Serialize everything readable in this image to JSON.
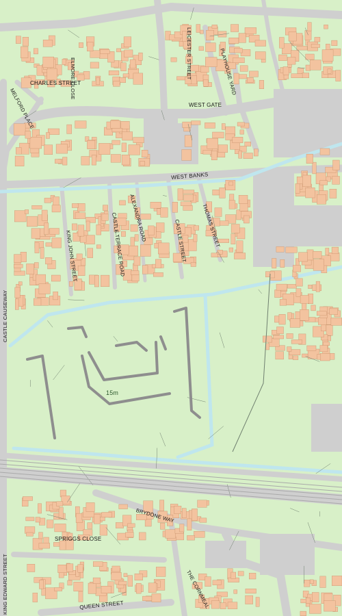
{
  "map": {
    "colors": {
      "land": "#d8f0c8",
      "building": "#f3c39f",
      "road": "#cfcfcf",
      "water": "#bfe6ee",
      "line": "#6f7f6f",
      "rail": "#a9a9a9",
      "outline": "#8e8e8e"
    },
    "labels": {
      "charles_street": "CHARLES STREET",
      "elmore_close": "ELMORE CLOSE",
      "melford_place": "MELFORD PLACE",
      "leicester_street": "LEICESTER STREET",
      "playhouse_yard": "PLAYHOUSE YARD",
      "west_gate": "WEST GATE",
      "west_banks": "WEST BANKS",
      "alexandra_road": "ALEXANDRA ROAD",
      "castle_terrace_road": "CASTLE TERRACE ROAD",
      "king_john_street": "KING JOHN STREET",
      "castle_street": "CASTLE STREET",
      "thomas_street": "THOMAS STREET",
      "castle_causeway": "CASTLE CAUSEWAY",
      "contour_15m": "15m",
      "brydone_way": "BRYDONE WAY",
      "spriggs_close": "SPRIGGS CLOSE",
      "king_edward_street": "KING EDWARD STREET",
      "queen_street": "QUEEN STREET",
      "the_cornmeal": "THE CORNMEAL"
    }
  }
}
